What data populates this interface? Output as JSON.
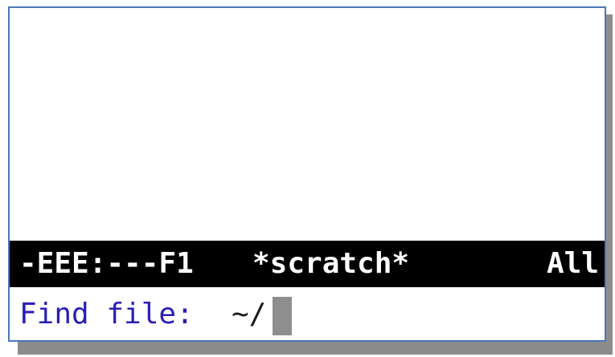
{
  "mode_line": {
    "status": "-EEE:---F1",
    "buffer_name": "*scratch*",
    "position": "All"
  },
  "minibuffer": {
    "prompt": "Find file:",
    "value": "~/"
  },
  "colors": {
    "mode_line_background": "#000000",
    "mode_line_text": "#ffffff",
    "prompt_text": "#2b1fb3",
    "cursor": "#8e8e8e",
    "window_border": "#4b78b7",
    "shadow": "#8c8c8c"
  }
}
